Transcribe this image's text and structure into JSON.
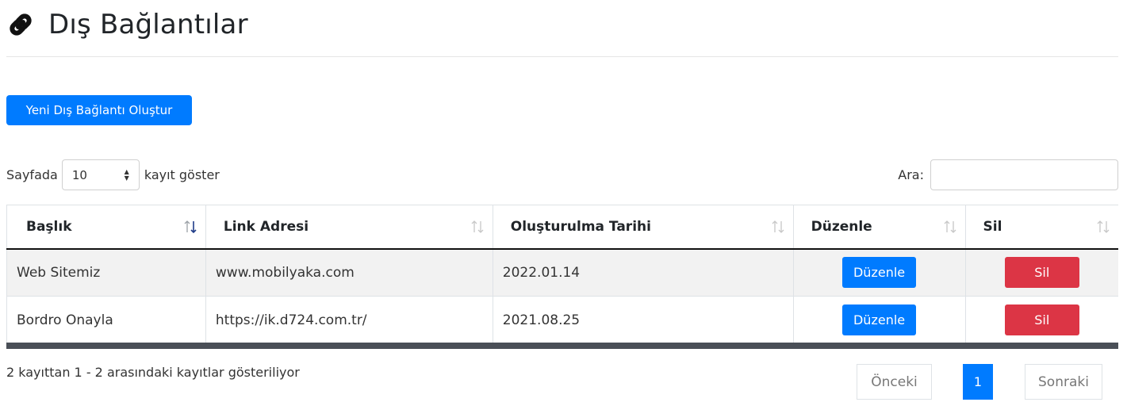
{
  "page": {
    "title": "Dış Bağlantılar"
  },
  "actions": {
    "create_label": "Yeni Dış Bağlantı Oluştur"
  },
  "length": {
    "prefix": "Sayfada",
    "value": "10",
    "suffix": "kayıt göster"
  },
  "search": {
    "label": "Ara:",
    "value": ""
  },
  "table": {
    "headers": [
      "Başlık",
      "Link Adresi",
      "Oluşturulma Tarihi",
      "Düzenle",
      "Sil"
    ],
    "rows": [
      {
        "title": "Web Sitemiz",
        "link": "www.mobilyaka.com",
        "date": "2022.01.14",
        "edit": "Düzenle",
        "delete": "Sil"
      },
      {
        "title": "Bordro Onayla",
        "link": "https://ik.d724.com.tr/",
        "date": "2021.08.25",
        "edit": "Düzenle",
        "delete": "Sil"
      }
    ]
  },
  "footer": {
    "info": "2 kayıttan 1 - 2 arasındaki kayıtlar gösteriliyor",
    "prev": "Önceki",
    "current_page": "1",
    "next": "Sonraki"
  },
  "colors": {
    "primary": "#007bff",
    "danger": "#dc3545"
  }
}
